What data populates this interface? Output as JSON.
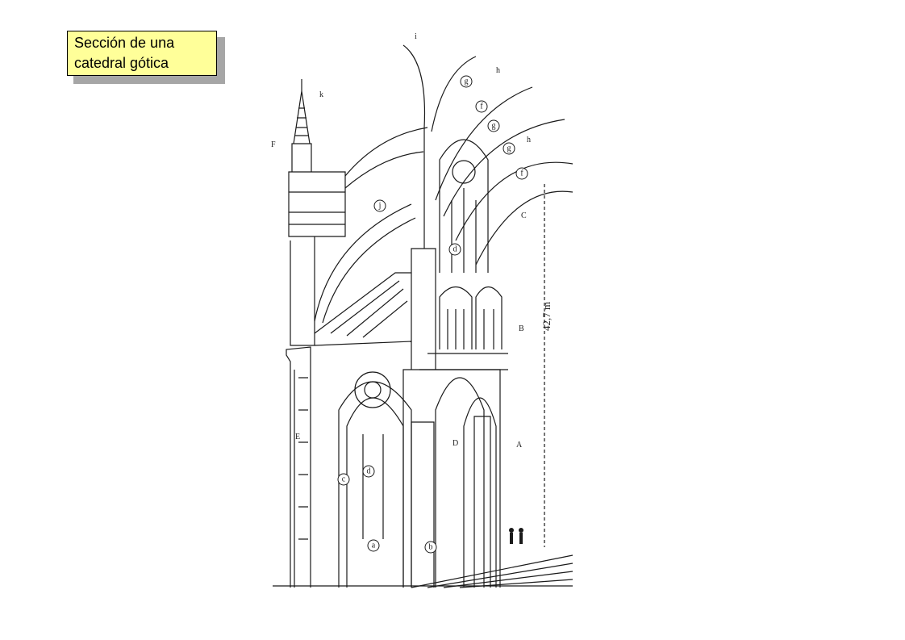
{
  "title": {
    "line1": "Sección de una",
    "line2": "catedral gótica"
  },
  "drawing": {
    "plain_labels": {
      "F": "F",
      "k": "k",
      "i": "i",
      "h1": "h",
      "h2": "h",
      "C": "C",
      "B": "B",
      "A": "A",
      "D": "D",
      "E": "E"
    },
    "circled_labels": {
      "g1": "g",
      "f1": "f",
      "g2": "g",
      "g3": "g",
      "f2": "f",
      "j": "j",
      "d1": "d",
      "d2": "d",
      "c": "c",
      "a": "a",
      "b": "b"
    },
    "height_annotation": "42,7 m"
  }
}
